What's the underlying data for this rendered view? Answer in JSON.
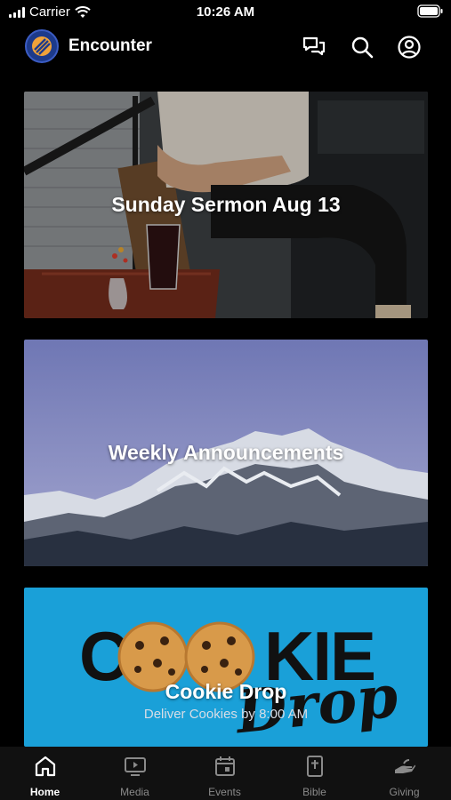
{
  "status_bar": {
    "carrier": "Carrier",
    "time": "10:26 AM"
  },
  "header": {
    "app_title": "Encounter",
    "icons": [
      "chat-icon",
      "search-icon",
      "account-icon"
    ],
    "logo_icon": "encounter-logo"
  },
  "cards": [
    {
      "title": "Sunday Sermon Aug 13"
    },
    {
      "title": "Weekly Announcements"
    },
    {
      "title": "Cookie Drop",
      "subtitle": "Deliver Cookies by 8:00 AM",
      "art_text": {
        "co": "CO",
        "kie": "KIE",
        "drop": "Drop"
      }
    }
  ],
  "tab_bar": {
    "tabs": [
      {
        "label": "Home",
        "icon": "home-icon",
        "active": true
      },
      {
        "label": "Media",
        "icon": "media-play-icon",
        "active": false
      },
      {
        "label": "Events",
        "icon": "calendar-icon",
        "active": false
      },
      {
        "label": "Bible",
        "icon": "bible-icon",
        "active": false
      },
      {
        "label": "Giving",
        "icon": "giving-hand-icon",
        "active": false
      }
    ]
  },
  "colors": {
    "background": "#000000",
    "cookie_card_bg": "#1aa0d8",
    "inactive_tab": "#8a8a8a"
  }
}
